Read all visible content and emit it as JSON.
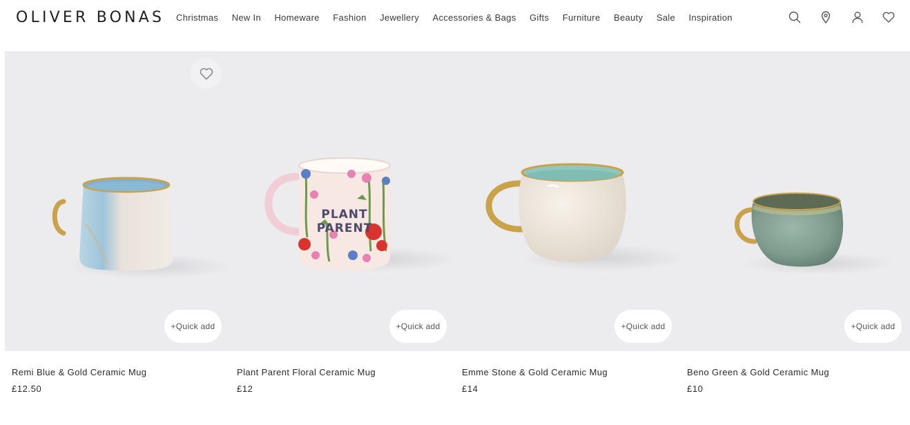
{
  "brand": {
    "logo_text": "OLIVER BONAS"
  },
  "nav": {
    "items": [
      "Christmas",
      "New In",
      "Homeware",
      "Fashion",
      "Jewellery",
      "Accessories & Bags",
      "Gifts",
      "Furniture",
      "Beauty",
      "Sale",
      "Inspiration"
    ]
  },
  "header_icons": [
    "search-icon",
    "store-locator-icon",
    "account-icon",
    "wishlist-icon"
  ],
  "products": [
    {
      "name": "Remi Blue & Gold Ceramic Mug",
      "price": "£12.50",
      "quick_add": "+Quick add"
    },
    {
      "name": "Plant Parent Floral Ceramic Mug",
      "price": "£12",
      "quick_add": "+Quick add",
      "mug_text": "PLANT PARENT"
    },
    {
      "name": "Emme Stone & Gold Ceramic Mug",
      "price": "£14",
      "quick_add": "+Quick add"
    },
    {
      "name": "Beno Green & Gold Ceramic Mug",
      "price": "£10",
      "quick_add": "+Quick add"
    }
  ],
  "colors": {
    "tile_bg": "#ecebee",
    "gold": "#c9a24a",
    "text": "#2b2b2b"
  }
}
